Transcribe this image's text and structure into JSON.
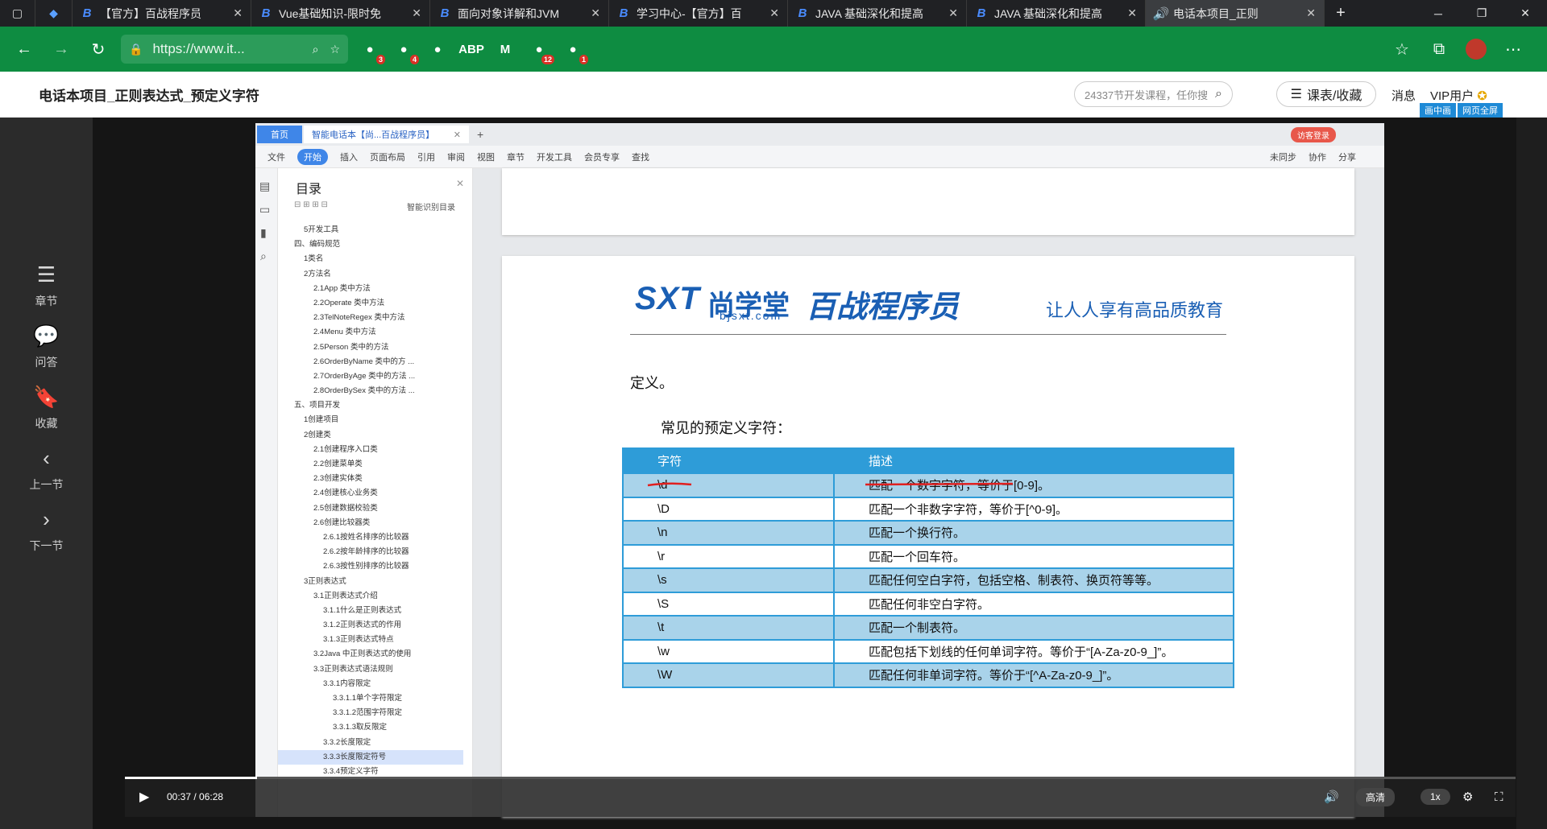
{
  "browser": {
    "tabs": [
      {
        "label": "【官方】百战程序员",
        "icon": "bz-logo-icon"
      },
      {
        "label": "Vue基础知识-限时免",
        "icon": "bz-logo-icon"
      },
      {
        "label": "面向对象详解和JVM",
        "icon": "bz-logo-icon"
      },
      {
        "label": "学习中心-【官方】百",
        "icon": "bz-logo-icon"
      },
      {
        "label": "JAVA 基础深化和提高",
        "icon": "bz-logo-icon"
      },
      {
        "label": "JAVA 基础深化和提高",
        "icon": "bz-logo-icon"
      },
      {
        "label": "电话本项目_正则",
        "icon": "bz-logo-icon",
        "active": true
      }
    ],
    "new_tab": "+",
    "address": "https://www.it...",
    "extensions": [
      {
        "name": "ext-1-icon",
        "badge": "3"
      },
      {
        "name": "ext-2-icon",
        "badge": "4"
      },
      {
        "name": "ext-3-icon",
        "badge": ""
      },
      {
        "name": "ext-abp-icon",
        "glyph": "ABP",
        "badge": ""
      },
      {
        "name": "ext-m-icon",
        "glyph": "M",
        "badge": ""
      },
      {
        "name": "ext-12-icon",
        "badge": "12"
      },
      {
        "name": "ext-1b-icon",
        "badge": "1"
      }
    ]
  },
  "header": {
    "title": "电话本项目_正则表达式_预定义字符",
    "search_placeholder": "24337节开发课程，任你搜",
    "course_btn": "课表/收藏",
    "msg": "消息",
    "vip": "VIP用户",
    "pip": "画中画",
    "fullpage": "网页全屏"
  },
  "leftnav": [
    {
      "label": "章节",
      "icon": "chapter-icon"
    },
    {
      "label": "问答",
      "icon": "qa-icon"
    },
    {
      "label": "收藏",
      "icon": "bookmark-icon"
    },
    {
      "label": "上一节",
      "icon": "prev-icon"
    },
    {
      "label": "下一节",
      "icon": "next-icon"
    }
  ],
  "wps": {
    "home_tab": "首页",
    "doc_tab": "智能电话本【尚...百战程序员】",
    "menu": [
      "文件",
      "开始",
      "插入",
      "页面布局",
      "引用",
      "审阅",
      "视图",
      "章节",
      "开发工具",
      "会员专享",
      "查找"
    ],
    "right_menu": [
      "未同步",
      "协作",
      "分享"
    ],
    "guest_login": "访客登录"
  },
  "toc": {
    "heading": "目录",
    "smart": "智能识别目录",
    "items": [
      {
        "t": "5开发工具",
        "lvl": 2
      },
      {
        "t": "四、编码规范",
        "lvl": 1
      },
      {
        "t": "1类名",
        "lvl": 2
      },
      {
        "t": "2方法名",
        "lvl": 2
      },
      {
        "t": "2.1App 类中方法",
        "lvl": 3
      },
      {
        "t": "2.2Operate 类中方法",
        "lvl": 3
      },
      {
        "t": "2.3TelNoteRegex 类中方法",
        "lvl": 3
      },
      {
        "t": "2.4Menu 类中方法",
        "lvl": 3
      },
      {
        "t": "2.5Person 类中的方法",
        "lvl": 3
      },
      {
        "t": "2.6OrderByName 类中的方 ...",
        "lvl": 3
      },
      {
        "t": "2.7OrderByAge 类中的方法 ...",
        "lvl": 3
      },
      {
        "t": "2.8OrderBySex 类中的方法 ...",
        "lvl": 3
      },
      {
        "t": "五、项目开发",
        "lvl": 1
      },
      {
        "t": "1创建项目",
        "lvl": 2
      },
      {
        "t": "2创建类",
        "lvl": 2
      },
      {
        "t": "2.1创建程序入口类",
        "lvl": 3
      },
      {
        "t": "2.2创建菜单类",
        "lvl": 3
      },
      {
        "t": "2.3创建实体类",
        "lvl": 3
      },
      {
        "t": "2.4创建核心业务类",
        "lvl": 3
      },
      {
        "t": "2.5创建数据校验类",
        "lvl": 3
      },
      {
        "t": "2.6创建比较器类",
        "lvl": 3
      },
      {
        "t": "2.6.1按姓名排序的比较器",
        "lvl": 4
      },
      {
        "t": "2.6.2按年龄排序的比较器",
        "lvl": 4
      },
      {
        "t": "2.6.3按性别排序的比较器",
        "lvl": 4
      },
      {
        "t": "3正则表达式",
        "lvl": 2
      },
      {
        "t": "3.1正则表达式介绍",
        "lvl": 3
      },
      {
        "t": "3.1.1什么是正则表达式",
        "lvl": 4
      },
      {
        "t": "3.1.2正则表达式的作用",
        "lvl": 4
      },
      {
        "t": "3.1.3正则表达式特点",
        "lvl": 4
      },
      {
        "t": "3.2Java 中正则表达式的使用",
        "lvl": 3
      },
      {
        "t": "3.3正则表达式语法规则",
        "lvl": 3
      },
      {
        "t": "3.3.1内容限定",
        "lvl": 4
      },
      {
        "t": "3.3.1.1单个字符限定",
        "lvl": 5
      },
      {
        "t": "3.3.1.2范围字符限定",
        "lvl": 5
      },
      {
        "t": "3.3.1.3取反限定",
        "lvl": 5
      },
      {
        "t": "3.3.2长度限定",
        "lvl": 4
      },
      {
        "t": "3.3.3长度限定符号",
        "lvl": 4,
        "sel": true
      },
      {
        "t": "3.3.4预定义字符",
        "lvl": 4
      }
    ]
  },
  "page": {
    "logo_sxt": "SXT",
    "logo_name": "尚学堂",
    "logo_domain": "bjsxt.com",
    "logo_bz": "百战程序员",
    "slogan": "让人人享有高品质教育",
    "def": "定义。",
    "caption": "常见的预定义字符：",
    "table_headers": [
      "字符",
      "描述"
    ],
    "table_rows": [
      [
        "\\d",
        "匹配一个数字字符，等价于[0-9]。"
      ],
      [
        "\\D",
        "匹配一个非数字字符，等价于[^0-9]。"
      ],
      [
        "\\n",
        "匹配一个换行符。"
      ],
      [
        "\\r",
        "匹配一个回车符。"
      ],
      [
        "\\s",
        "匹配任何空白字符，包括空格、制表符、换页符等等。"
      ],
      [
        "\\S",
        "匹配任何非空白字符。"
      ],
      [
        "\\t",
        "匹配一个制表符。"
      ],
      [
        "\\w",
        "匹配包括下划线的任何单词字符。等价于“[A-Za-z0-9_]”。"
      ],
      [
        "\\W",
        "匹配任何非单词字符。等价于“[^A-Za-z0-9_]”。"
      ]
    ]
  },
  "player": {
    "time": "00:37 / 06:28",
    "progress": 0.095,
    "quality": "高清",
    "speed": "1x"
  }
}
